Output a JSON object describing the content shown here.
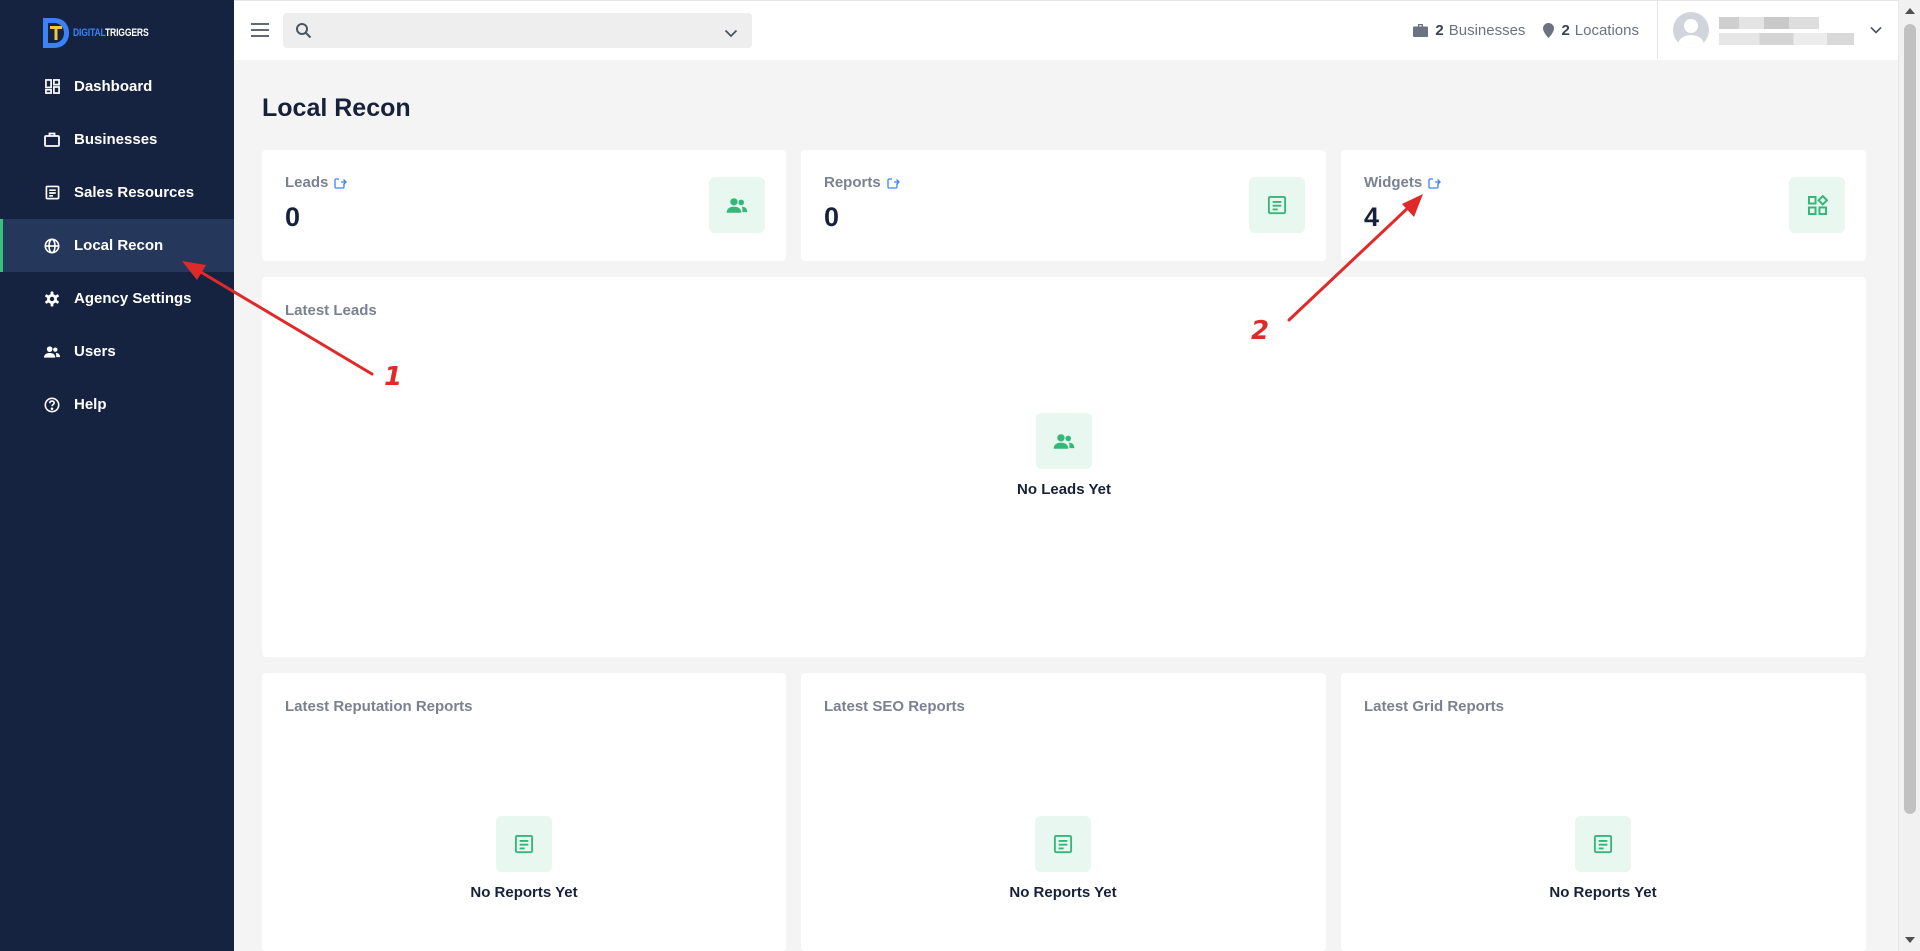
{
  "brand": {
    "part1": "DIGITAL",
    "part2": "TRIGGERS"
  },
  "sidebar": {
    "items": [
      {
        "label": "Dashboard",
        "icon": "dashboard-icon"
      },
      {
        "label": "Businesses",
        "icon": "briefcase-icon"
      },
      {
        "label": "Sales Resources",
        "icon": "document-icon"
      },
      {
        "label": "Local Recon",
        "icon": "globe-icon",
        "active": true
      },
      {
        "label": "Agency Settings",
        "icon": "gear-icon"
      },
      {
        "label": "Users",
        "icon": "users-icon"
      },
      {
        "label": "Help",
        "icon": "help-icon"
      }
    ]
  },
  "topbar": {
    "search_value": "",
    "businesses_count": "2",
    "businesses_label": "Businesses",
    "locations_count": "2",
    "locations_label": "Locations"
  },
  "page": {
    "title": "Local Recon"
  },
  "stats": [
    {
      "label": "Leads",
      "value": "0",
      "icon": "users-icon"
    },
    {
      "label": "Reports",
      "value": "0",
      "icon": "report-icon"
    },
    {
      "label": "Widgets",
      "value": "4",
      "icon": "widgets-icon"
    }
  ],
  "latest_leads": {
    "title": "Latest Leads",
    "empty_message": "No Leads Yet"
  },
  "report_sections": [
    {
      "title": "Latest Reputation Reports",
      "empty_message": "No Reports Yet"
    },
    {
      "title": "Latest SEO Reports",
      "empty_message": "No Reports Yet"
    },
    {
      "title": "Latest Grid Reports",
      "empty_message": "No Reports Yet"
    }
  ],
  "annotations": [
    {
      "number": "1"
    },
    {
      "number": "2"
    }
  ],
  "colors": {
    "sidebar_bg": "#152341",
    "active_item_bg": "#25375b",
    "accent_green": "#34c27e",
    "link_blue": "#3b82f6",
    "annotation_red": "#e02a2a"
  }
}
